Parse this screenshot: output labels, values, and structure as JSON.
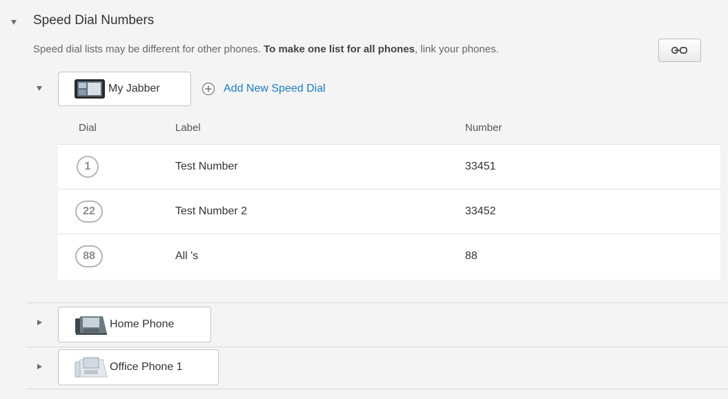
{
  "section": {
    "title": "Speed Dial Numbers",
    "description_plain": "Speed dial lists may be different for other phones. ",
    "description_bold": "To make one list for all phones",
    "description_tail": ", link your phones.",
    "link_icon": "link-icon"
  },
  "devices": [
    {
      "name": "My Jabber",
      "icon": "tablet-icon",
      "expanded": true,
      "add_label": "Add New Speed Dial",
      "add_icon": "plus-circle-icon",
      "columns": {
        "dial": "Dial",
        "label": "Label",
        "number": "Number"
      },
      "rows": [
        {
          "dial": "1",
          "label": "Test Number",
          "number": "33451"
        },
        {
          "dial": "22",
          "label": "Test Number 2",
          "number": "33452"
        },
        {
          "dial": "88",
          "label": "All 's",
          "number": "88"
        }
      ]
    },
    {
      "name": "Home Phone",
      "icon": "desk-phone-icon",
      "expanded": false
    },
    {
      "name": "Office Phone 1",
      "icon": "desk-phone-white-icon",
      "expanded": false
    }
  ],
  "colors": {
    "accent": "#1b7dbf",
    "background": "#f4f4f4",
    "row_background": "#ffffff"
  }
}
